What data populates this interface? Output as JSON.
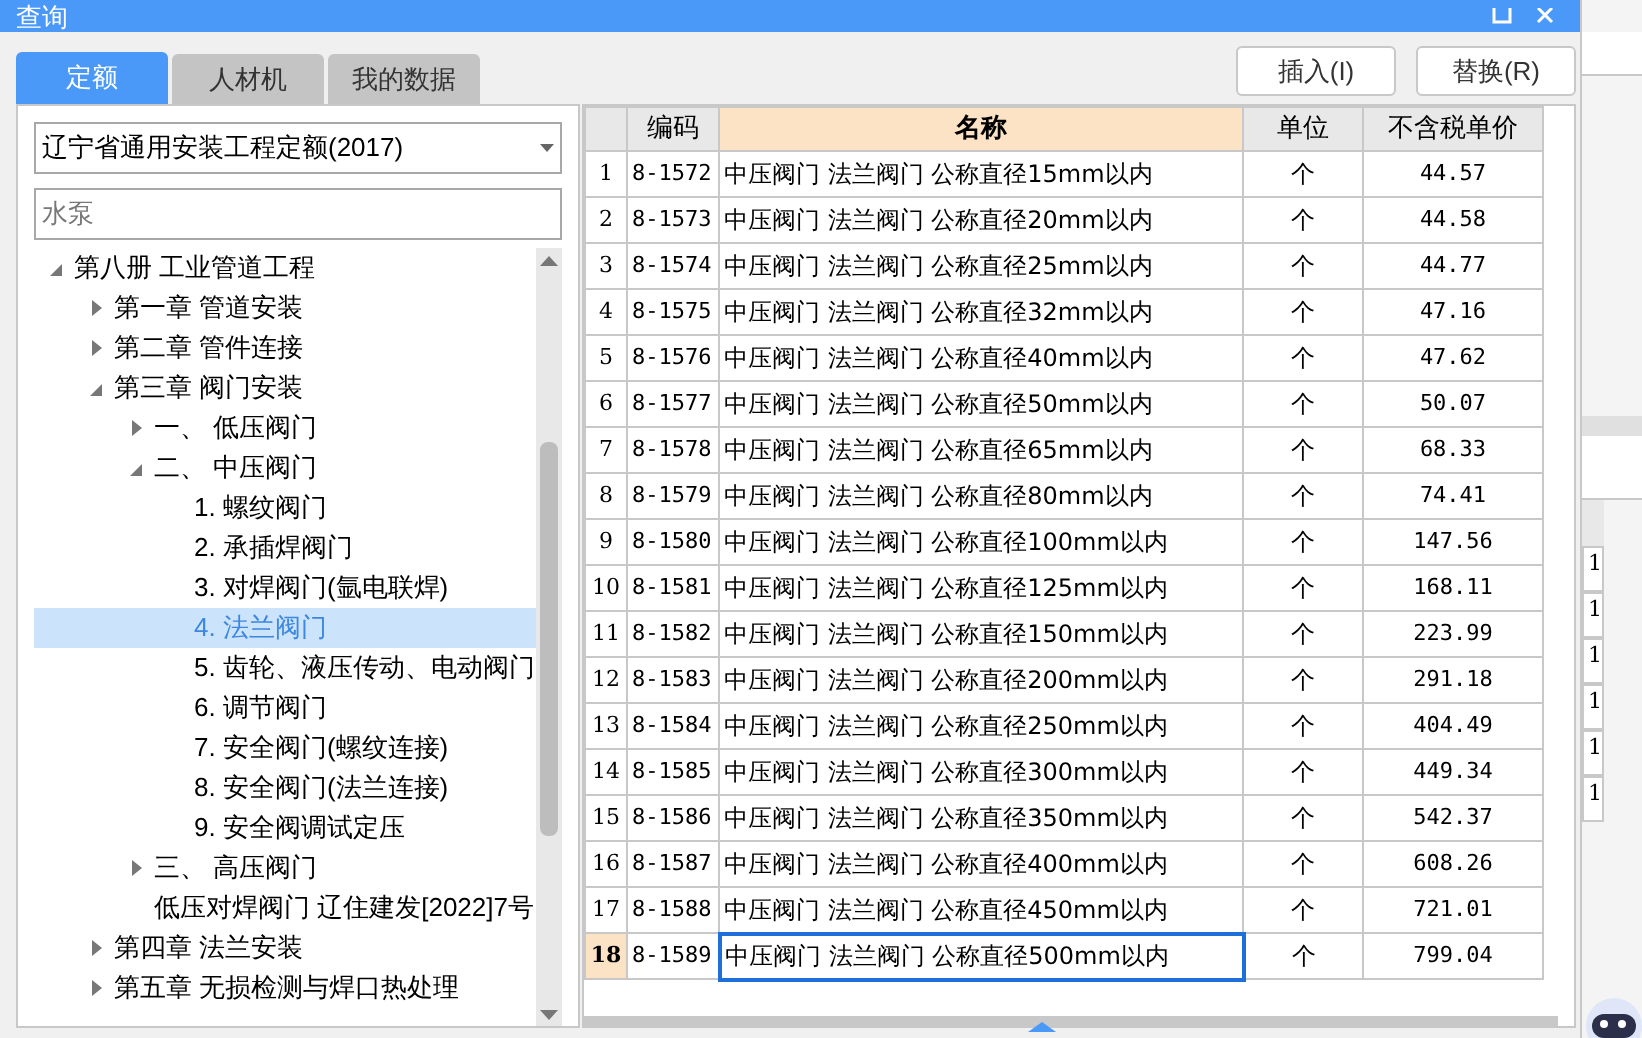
{
  "window": {
    "title": "查询"
  },
  "tabs": [
    {
      "label": "定额",
      "selected": true
    },
    {
      "label": "人材机",
      "selected": false
    },
    {
      "label": "我的数据",
      "selected": false
    }
  ],
  "library_select": {
    "value": "辽宁省通用安装工程定额(2017)"
  },
  "search": {
    "value": "水泵"
  },
  "tree": [
    {
      "label": "第八册 工业管道工程",
      "expanded": true,
      "selected": false,
      "children": [
        {
          "label": "第一章 管道安装",
          "expanded": false,
          "selected": false
        },
        {
          "label": "第二章 管件连接",
          "expanded": false,
          "selected": false
        },
        {
          "label": "第三章 阀门安装",
          "expanded": true,
          "selected": false,
          "children": [
            {
              "label": "一、  低压阀门",
              "expanded": false,
              "selected": false
            },
            {
              "label": "二、  中压阀门",
              "expanded": true,
              "selected": false,
              "children": [
                {
                  "label": "1. 螺纹阀门",
                  "selected": false
                },
                {
                  "label": "2. 承插焊阀门",
                  "selected": false
                },
                {
                  "label": "3. 对焊阀门(氩电联焊)",
                  "selected": false
                },
                {
                  "label": "4. 法兰阀门",
                  "selected": true
                },
                {
                  "label": "5. 齿轮、液压传动、电动阀门",
                  "selected": false
                },
                {
                  "label": "6. 调节阀门",
                  "selected": false
                },
                {
                  "label": "7. 安全阀门(螺纹连接)",
                  "selected": false
                },
                {
                  "label": "8. 安全阀门(法兰连接)",
                  "selected": false
                },
                {
                  "label": "9. 安全阀调试定压",
                  "selected": false
                }
              ]
            },
            {
              "label": "三、  高压阀门",
              "expanded": false,
              "selected": false
            },
            {
              "label": "低压对焊阀门 辽住建发[2022]7号",
              "selected": false
            }
          ]
        },
        {
          "label": "第四章 法兰安装",
          "expanded": false,
          "selected": false
        },
        {
          "label": "第五章 无损检测与焊口热处理",
          "expanded": false,
          "selected": false
        }
      ]
    }
  ],
  "buttons": [
    "插入(I)",
    "替换(R)"
  ],
  "table": {
    "columns": [
      {
        "label": "编码",
        "selected": false
      },
      {
        "label": "名称",
        "selected": true
      },
      {
        "label": "单位",
        "selected": false
      },
      {
        "label": "不含税单价",
        "selected": false
      }
    ],
    "rows": [
      {
        "index": "1",
        "code": "8-1572",
        "name": "中压阀门 法兰阀门 公称直径15mm以内",
        "unit": "个",
        "price": "44.57",
        "selected": false
      },
      {
        "index": "2",
        "code": "8-1573",
        "name": "中压阀门 法兰阀门 公称直径20mm以内",
        "unit": "个",
        "price": "44.58",
        "selected": false
      },
      {
        "index": "3",
        "code": "8-1574",
        "name": "中压阀门 法兰阀门 公称直径25mm以内",
        "unit": "个",
        "price": "44.77",
        "selected": false
      },
      {
        "index": "4",
        "code": "8-1575",
        "name": "中压阀门 法兰阀门 公称直径32mm以内",
        "unit": "个",
        "price": "47.16",
        "selected": false
      },
      {
        "index": "5",
        "code": "8-1576",
        "name": "中压阀门 法兰阀门 公称直径40mm以内",
        "unit": "个",
        "price": "47.62",
        "selected": false
      },
      {
        "index": "6",
        "code": "8-1577",
        "name": "中压阀门 法兰阀门 公称直径50mm以内",
        "unit": "个",
        "price": "50.07",
        "selected": false
      },
      {
        "index": "7",
        "code": "8-1578",
        "name": "中压阀门 法兰阀门 公称直径65mm以内",
        "unit": "个",
        "price": "68.33",
        "selected": false
      },
      {
        "index": "8",
        "code": "8-1579",
        "name": "中压阀门 法兰阀门 公称直径80mm以内",
        "unit": "个",
        "price": "74.41",
        "selected": false
      },
      {
        "index": "9",
        "code": "8-1580",
        "name": "中压阀门 法兰阀门 公称直径100mm以内",
        "unit": "个",
        "price": "147.56",
        "selected": false
      },
      {
        "index": "10",
        "code": "8-1581",
        "name": "中压阀门 法兰阀门 公称直径125mm以内",
        "unit": "个",
        "price": "168.11",
        "selected": false
      },
      {
        "index": "11",
        "code": "8-1582",
        "name": "中压阀门 法兰阀门 公称直径150mm以内",
        "unit": "个",
        "price": "223.99",
        "selected": false
      },
      {
        "index": "12",
        "code": "8-1583",
        "name": "中压阀门 法兰阀门 公称直径200mm以内",
        "unit": "个",
        "price": "291.18",
        "selected": false
      },
      {
        "index": "13",
        "code": "8-1584",
        "name": "中压阀门 法兰阀门 公称直径250mm以内",
        "unit": "个",
        "price": "404.49",
        "selected": false
      },
      {
        "index": "14",
        "code": "8-1585",
        "name": "中压阀门 法兰阀门 公称直径300mm以内",
        "unit": "个",
        "price": "449.34",
        "selected": false
      },
      {
        "index": "15",
        "code": "8-1586",
        "name": "中压阀门 法兰阀门 公称直径350mm以内",
        "unit": "个",
        "price": "542.37",
        "selected": false
      },
      {
        "index": "16",
        "code": "8-1587",
        "name": "中压阀门 法兰阀门 公称直径400mm以内",
        "unit": "个",
        "price": "608.26",
        "selected": false
      },
      {
        "index": "17",
        "code": "8-1588",
        "name": "中压阀门 法兰阀门 公称直径450mm以内",
        "unit": "个",
        "price": "721.01",
        "selected": false
      },
      {
        "index": "18",
        "code": "8-1589",
        "name": "中压阀门 法兰阀门 公称直径500mm以内",
        "unit": "个",
        "price": "799.04",
        "selected": true
      }
    ]
  },
  "background_cells": [
    "1",
    "1",
    "1",
    "1",
    "1",
    "1"
  ]
}
